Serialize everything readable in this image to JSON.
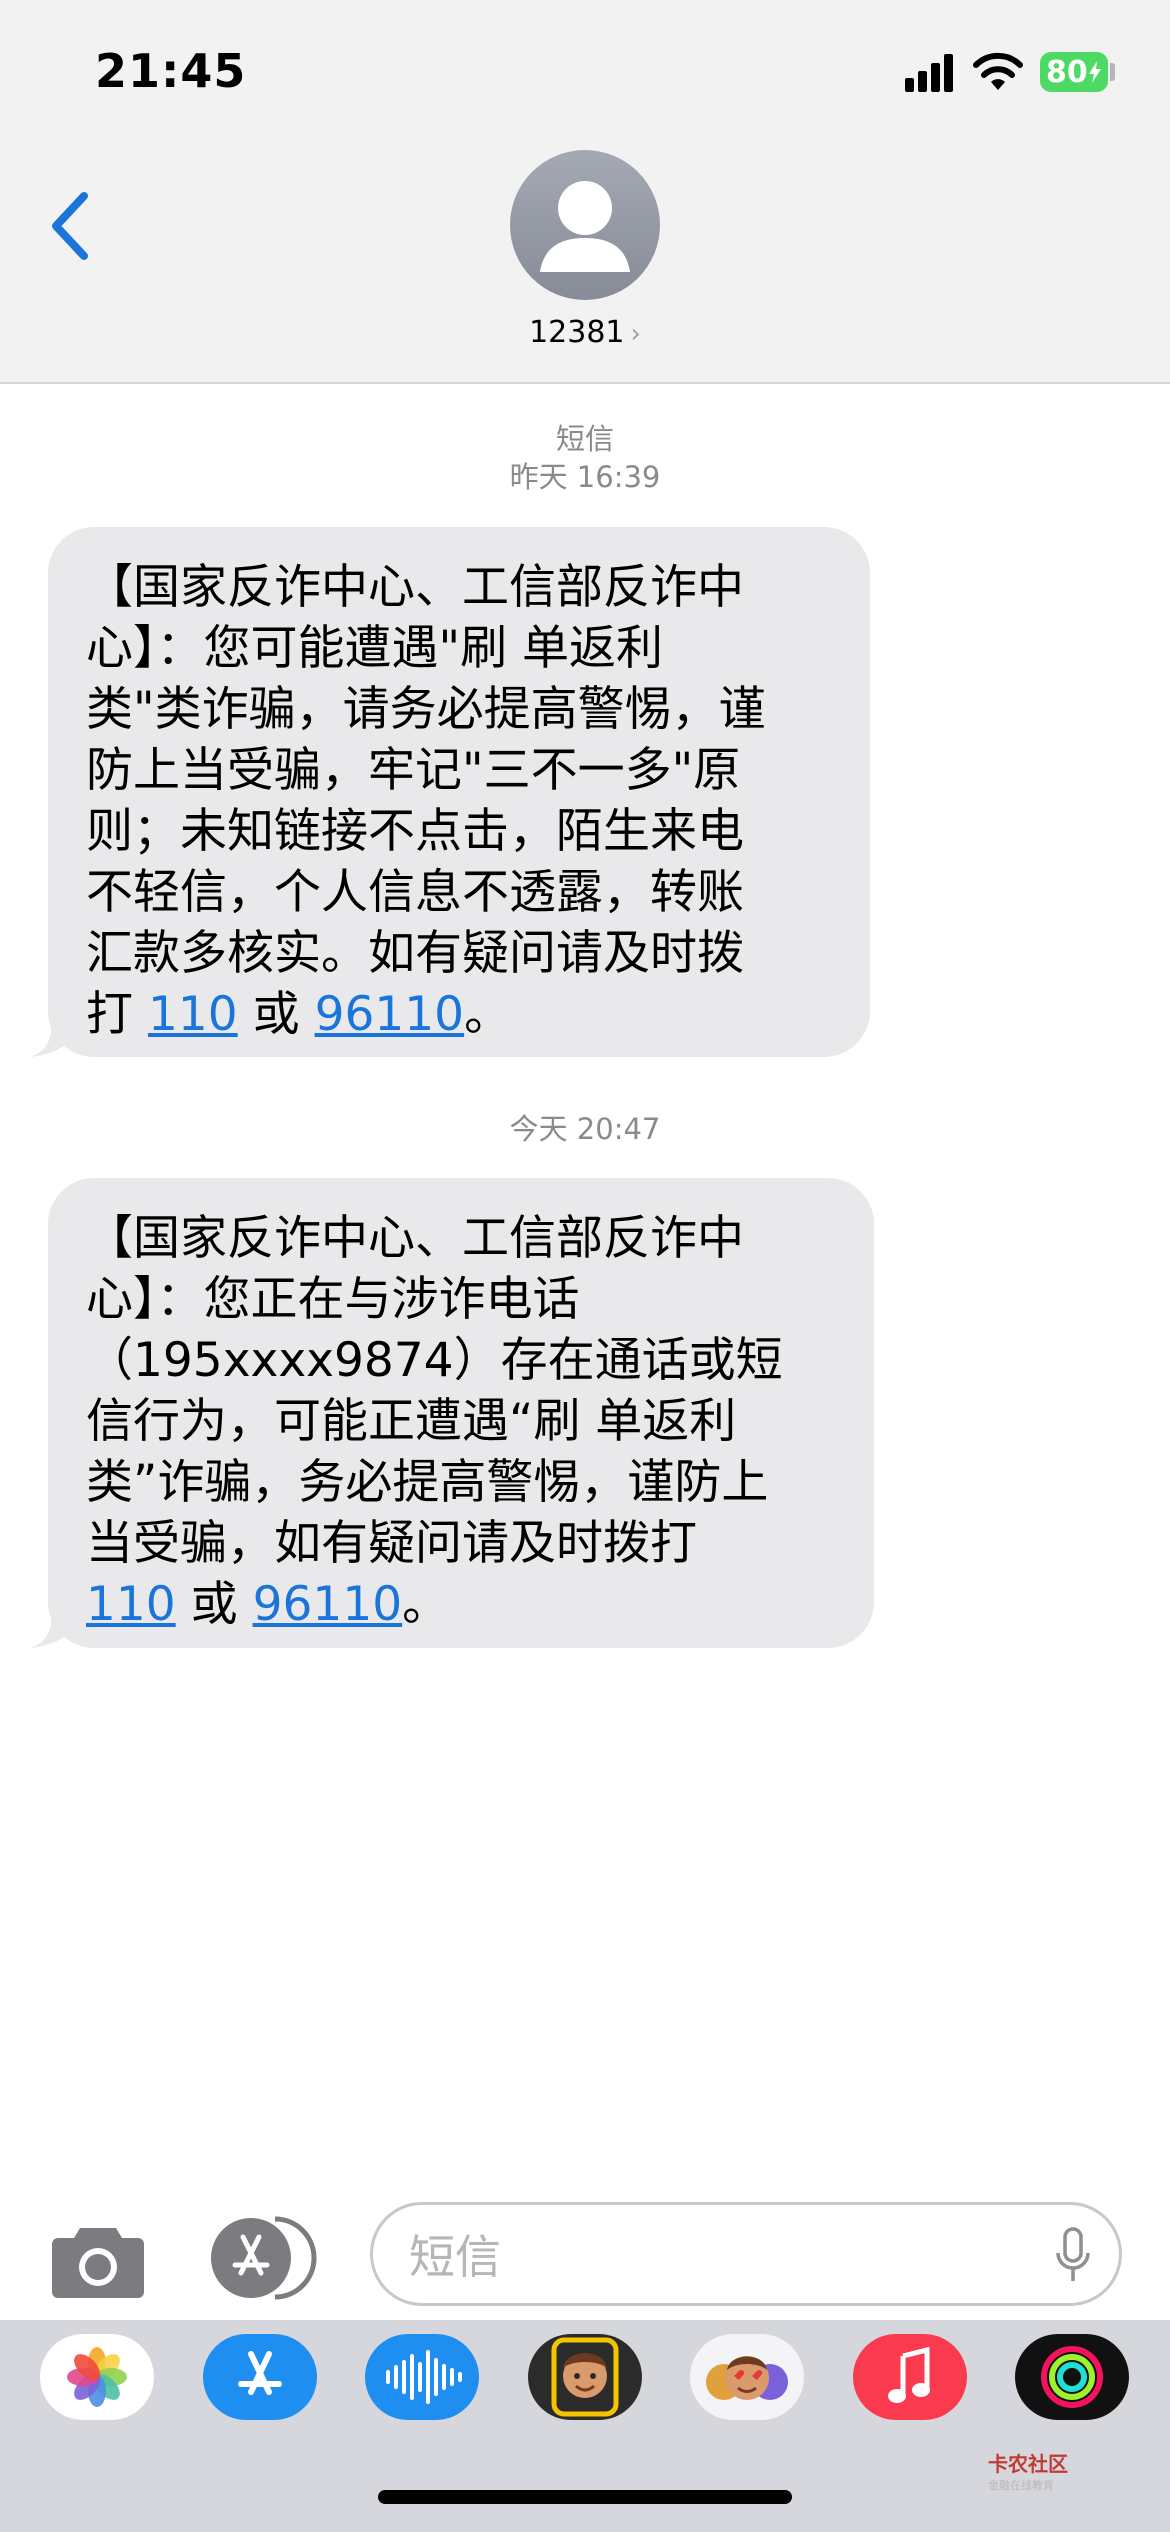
{
  "status_bar": {
    "time": "21:45",
    "battery": "80",
    "battery_color": "#4cd964"
  },
  "header": {
    "back_icon": "chevron-left-icon",
    "contact_name": "12381",
    "contact_chevron": "›",
    "accent": "#1a74d9"
  },
  "thread": {
    "service_label": "短信",
    "messages": [
      {
        "timestamp": "昨天 16:39",
        "text": "【国家反诈中心、工信部反诈中\n心】：您可能遭遇\"刷 单返利\n类\"类诈骗，请务必提高警惕，谨\n防上当受骗，牢记\"三不一多\"原\n则；未知链接不点击，陌生来电\n不轻信，个人信息不透露，转账\n汇款多核实。如有疑问请及时拨\n打 ",
        "link1": "110",
        "mid": " 或 ",
        "link2": "96110",
        "end": "。"
      },
      {
        "timestamp": "今天 20:47",
        "text": "【国家反诈中心、工信部反诈中\n心】：您正在与涉诈电话\n（195xxxx9874）存在通话或短\n信行为，可能正遭遇“刷 单返利\n类”诈骗，务必提高警惕，谨防上\n当受骗，如有疑问请及时拨打\n",
        "link1": "110",
        "mid": " 或 ",
        "link2": "96110",
        "end": "。"
      }
    ]
  },
  "composer": {
    "placeholder": "短信",
    "camera_icon": "camera-icon",
    "apps_icon": "app-store-icon",
    "mic_icon": "microphone-icon"
  },
  "app_drawer": {
    "apps": [
      "photos-icon",
      "app-store-icon",
      "audio-message-icon",
      "memoji-icon",
      "animoji-stickers-icon",
      "music-icon",
      "activity-icon"
    ]
  },
  "watermark": {
    "text": "卡农社区",
    "sub": "金融在线教育"
  }
}
